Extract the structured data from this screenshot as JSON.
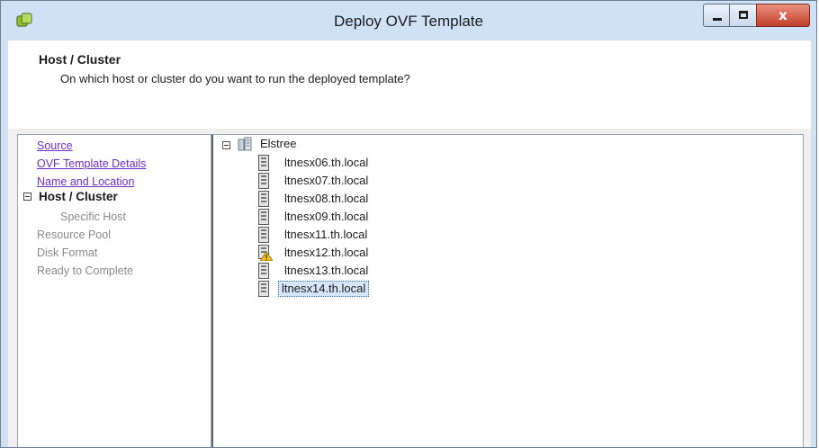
{
  "window": {
    "title": "Deploy OVF Template",
    "buttons": {
      "minimize": "–",
      "maximize": "□",
      "close": "x"
    }
  },
  "header": {
    "title": "Host / Cluster",
    "subtitle": "On which host or cluster do you want to run the deployed template?"
  },
  "nav": {
    "items": [
      {
        "label": "Source",
        "state": "link"
      },
      {
        "label": "OVF Template Details",
        "state": "link"
      },
      {
        "label": "Name and Location",
        "state": "link"
      },
      {
        "label": "Host / Cluster",
        "state": "current"
      },
      {
        "label": "Specific Host",
        "state": "disabled"
      },
      {
        "label": "Resource Pool",
        "state": "disabled"
      },
      {
        "label": "Disk Format",
        "state": "disabled"
      },
      {
        "label": "Ready to Complete",
        "state": "disabled"
      }
    ]
  },
  "tree": {
    "datacenter": "Elstree",
    "hosts": [
      {
        "name": "ltnesx06.th.local",
        "warning": false
      },
      {
        "name": "ltnesx07.th.local",
        "warning": false
      },
      {
        "name": "ltnesx08.th.local",
        "warning": false
      },
      {
        "name": "ltnesx09.th.local",
        "warning": false
      },
      {
        "name": "ltnesx11.th.local",
        "warning": false
      },
      {
        "name": "ltnesx12.th.local",
        "warning": true
      },
      {
        "name": "ltnesx13.th.local",
        "warning": false
      },
      {
        "name": "ltnesx14.th.local",
        "warning": false,
        "selected": true
      }
    ]
  },
  "colors": {
    "titlebar": "#cfe1f4",
    "link": "#6a2fc6",
    "selection": "#d5e6fa",
    "close_button": "#c33f2b"
  },
  "icons": {
    "app": "vsphere-ovf-icon",
    "datacenter": "datacenter-icon",
    "host": "server-host-icon",
    "warning": "warning-triangle-icon"
  }
}
